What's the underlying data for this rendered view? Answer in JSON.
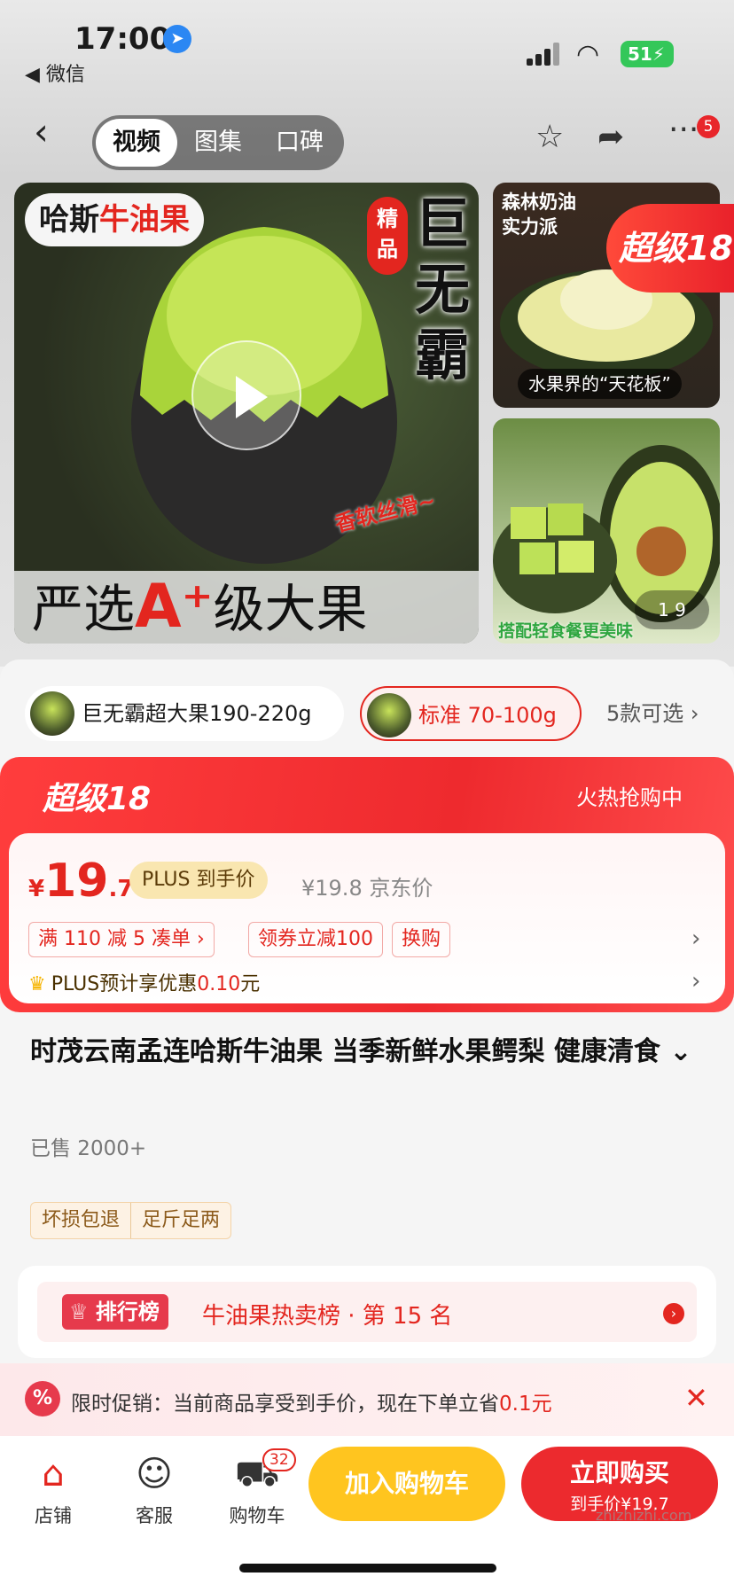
{
  "status_bar": {
    "time": "17:00",
    "back_app": "◀ 微信",
    "battery": "51"
  },
  "nav": {
    "tabs": [
      "视频",
      "图集",
      "口碑"
    ],
    "badge": "5"
  },
  "media": {
    "main_tag_1": "哈斯",
    "main_tag_2": "牛油果",
    "jingpin": "精品",
    "big_title": "巨无霸",
    "slogan": "香软丝滑~",
    "banner_1": "严选",
    "banner_a": "A⁺",
    "banner_2": "级大果",
    "side1_text": "森林奶油\n实力派",
    "side1_caption": "水果界的“天花板”",
    "chaoji_badge": "超级18",
    "side2_caption": "搭配轻食餐更美味",
    "page_indicator": "1   9"
  },
  "variants": {
    "items": [
      "巨无霸超大果190-220g",
      "标准 70-100g"
    ],
    "more": "5款可选 ›"
  },
  "promo": {
    "title": "超级18",
    "hot": "火热抢购中",
    "currency": "¥",
    "price_int": "19",
    "price_dec": ".7",
    "plus_tag": "PLUS 到手价",
    "jd_price": "¥19.8 京东价",
    "chips": [
      "满 110 减 5  凑单 ›",
      "领券立减100",
      "换购"
    ],
    "plus_line_prefix": "PLUS预计享优惠",
    "plus_line_value": "0.10",
    "plus_line_unit": "元"
  },
  "product": {
    "title": "时茂云南孟连哈斯牛油果 当季新鲜水果鳄梨 健康清食 ⌄",
    "sold": "已售 2000+",
    "guarantees": [
      "坏损包退",
      "足斤足两"
    ]
  },
  "rank": {
    "tag": "排行榜",
    "text": "牛油果热卖榜 · 第 15 名"
  },
  "limit": {
    "prefix": "限时促销：当前商品享受到手价，现在下单立省",
    "value": "0.1",
    "unit": "元"
  },
  "bottom": {
    "tools": [
      "店铺",
      "客服",
      "购物车"
    ],
    "cart_count": "32",
    "add_cart": "加入购物车",
    "buy": "立即购买",
    "buy_sub": "到手价¥19.7"
  },
  "watermark": "zhizhizhi.com"
}
